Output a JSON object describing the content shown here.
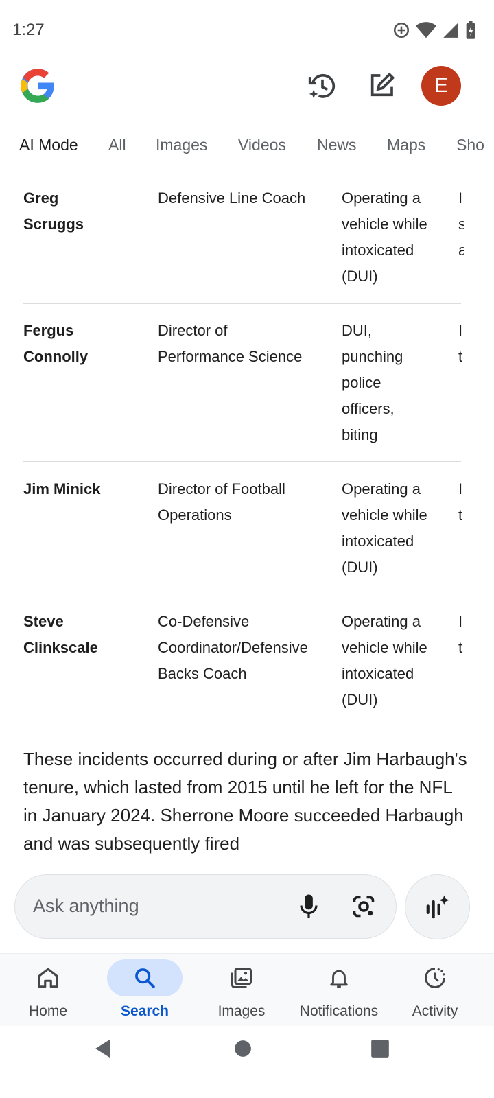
{
  "status_bar": {
    "time": "1:27"
  },
  "header": {
    "logo": "google-g-logo",
    "avatar_letter": "E",
    "avatar_color": "#c0391b"
  },
  "tabs": [
    {
      "label": "AI Mode",
      "active": true
    },
    {
      "label": "All"
    },
    {
      "label": "Images"
    },
    {
      "label": "Videos"
    },
    {
      "label": "News"
    },
    {
      "label": "Maps"
    },
    {
      "label": "Sho"
    }
  ],
  "table": {
    "rows": [
      {
        "name": [
          "Greg",
          "Scruggs"
        ],
        "role": [
          "Defensive Line Coach"
        ],
        "issue": [
          "Operating a",
          "vehicle while",
          "intoxicated",
          "(DUI)"
        ],
        "clip": [
          "I",
          "s",
          "a"
        ]
      },
      {
        "name": [
          "Fergus",
          "Connolly"
        ],
        "role": [
          "Director of",
          "Performance Science"
        ],
        "issue": [
          "DUI,",
          "punching",
          "police",
          "officers,",
          "biting"
        ],
        "clip": [
          "I",
          "t"
        ]
      },
      {
        "name": [
          "Jim Minick"
        ],
        "role": [
          "Director of Football",
          "Operations"
        ],
        "issue": [
          "Operating a",
          "vehicle while",
          "intoxicated",
          "(DUI)"
        ],
        "clip": [
          "I",
          "t"
        ]
      },
      {
        "name": [
          "Steve",
          "Clinkscale"
        ],
        "role": [
          "Co-Defensive",
          "Coordinator/Defensive",
          "Backs Coach"
        ],
        "issue": [
          "Operating a",
          "vehicle while",
          "intoxicated",
          "(DUI)"
        ],
        "clip": [
          "I",
          "t"
        ]
      }
    ]
  },
  "summary": {
    "text": "These incidents occurred during or after Jim Harbaugh's tenure, which lasted from 2015 until he left for the NFL in January 2024. Sherrone Moore succeeded Harbaugh and was subsequently fired"
  },
  "ask_bar": {
    "placeholder": "Ask anything"
  },
  "bottom_nav": [
    {
      "label": "Home",
      "icon": "home-icon"
    },
    {
      "label": "Search",
      "icon": "search-icon",
      "active": true
    },
    {
      "label": "Images",
      "icon": "images-icon"
    },
    {
      "label": "Notifications",
      "icon": "bell-icon"
    },
    {
      "label": "Activity",
      "icon": "activity-icon"
    }
  ],
  "colors": {
    "accent": "#0b57d0",
    "active_pill": "#d3e3fd"
  }
}
